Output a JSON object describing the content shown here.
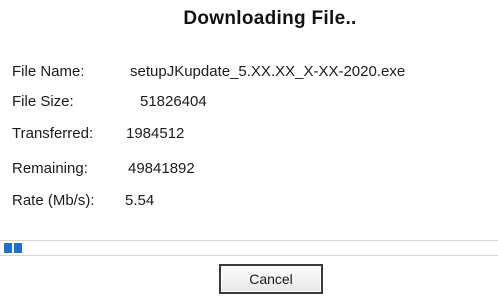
{
  "dialog": {
    "title": "Downloading File..",
    "file_name_label": "File Name:",
    "file_name_value": "setupJKupdate_5.XX.XX_X-XX-2020.exe",
    "file_size_label": "File Size:",
    "file_size_value": "51826404",
    "transferred_label": "Transferred:",
    "transferred_value": "1984512",
    "remaining_label": "Remaining:",
    "remaining_value": "49841892",
    "rate_label": "Rate (Mb/s):",
    "rate_value": "5.54",
    "progress_fraction": 0.038,
    "cancel_label": "Cancel"
  },
  "colors": {
    "progress_fill": "#1f6fd6",
    "background": "#ffffff"
  }
}
